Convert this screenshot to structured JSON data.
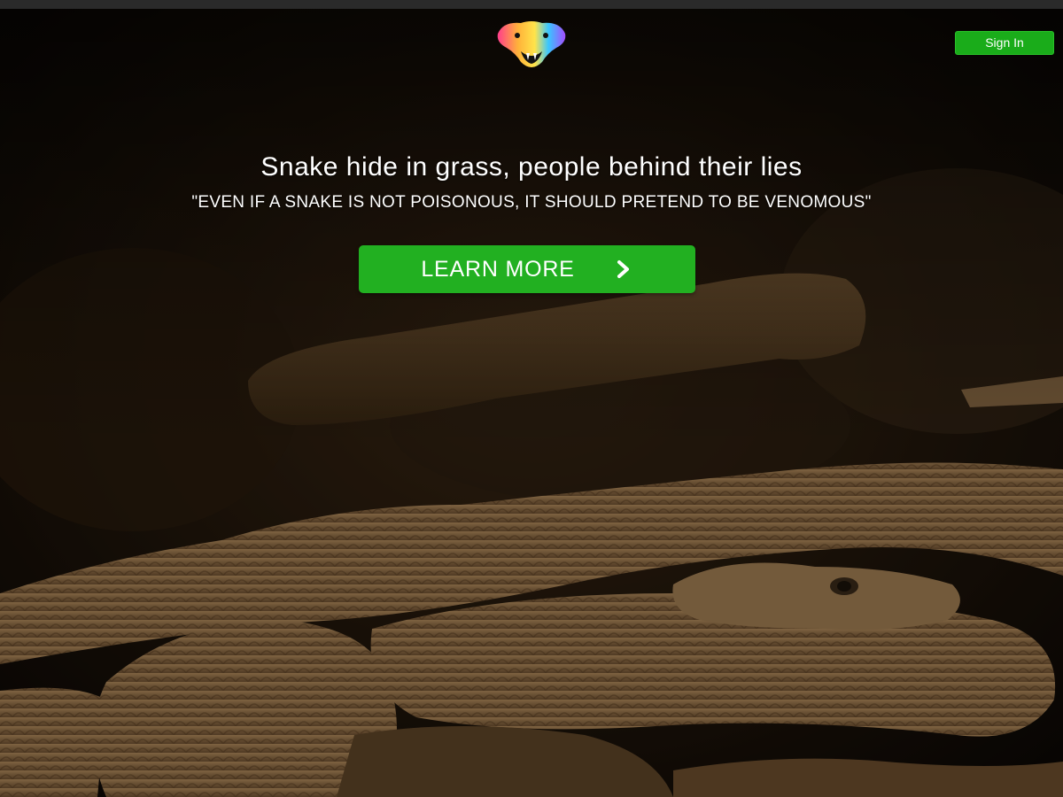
{
  "header": {
    "logo_icon": "snake-head-logo-icon",
    "signin_label": "Sign In"
  },
  "hero": {
    "headline": "Snake hide in grass, people behind their lies",
    "quote": "\"EVEN IF A SNAKE IS NOT POISONOUS, IT SHOULD PRETEND TO BE VENOMOUS\"",
    "cta_label": "LEARN MORE",
    "cta_icon": "chevron-right-icon",
    "background_image": "coiled-rattlesnake-on-rocks-photo"
  },
  "colors": {
    "accent_green": "#1aac1a",
    "text": "#ffffff",
    "background_dark": "#0f0b07"
  }
}
